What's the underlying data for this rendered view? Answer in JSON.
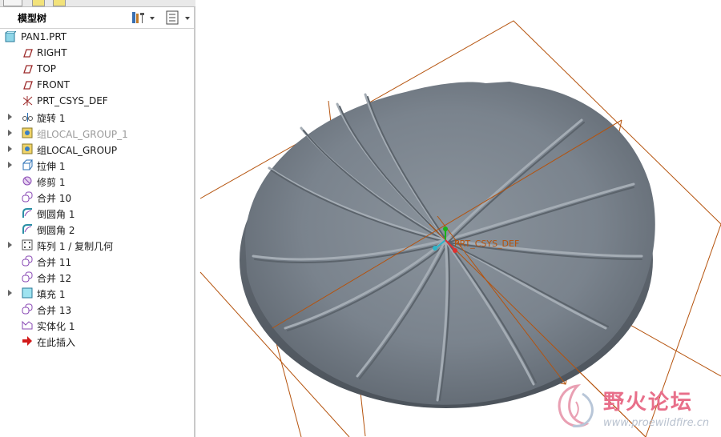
{
  "panel": {
    "title": "模型树",
    "settings_icon": "tree-settings-icon",
    "show_icon": "tree-columns-icon"
  },
  "tree": {
    "root": "PAN1.PRT",
    "items": [
      {
        "label": "RIGHT",
        "icon": "datum-plane-icon",
        "expandable": false,
        "dim": false
      },
      {
        "label": "TOP",
        "icon": "datum-plane-icon",
        "expandable": false,
        "dim": false
      },
      {
        "label": "FRONT",
        "icon": "datum-plane-icon",
        "expandable": false,
        "dim": false
      },
      {
        "label": "PRT_CSYS_DEF",
        "icon": "coordinate-system-icon",
        "expandable": false,
        "dim": false
      },
      {
        "label": "旋转 1",
        "icon": "revolve-icon",
        "expandable": true,
        "dim": false
      },
      {
        "label": "组LOCAL_GROUP_1",
        "icon": "group-icon",
        "expandable": true,
        "dim": true
      },
      {
        "label": "组LOCAL_GROUP",
        "icon": "group-icon",
        "expandable": true,
        "dim": false
      },
      {
        "label": "拉伸 1",
        "icon": "extrude-icon",
        "expandable": true,
        "dim": false
      },
      {
        "label": "修剪 1",
        "icon": "trim-icon",
        "expandable": false,
        "dim": false
      },
      {
        "label": "合并 10",
        "icon": "merge-icon",
        "expandable": false,
        "dim": false
      },
      {
        "label": "倒圆角 1",
        "icon": "round-icon",
        "expandable": false,
        "dim": false
      },
      {
        "label": "倒圆角 2",
        "icon": "round-icon",
        "expandable": false,
        "dim": false
      },
      {
        "label": "阵列 1 / 复制几何",
        "icon": "pattern-icon",
        "expandable": true,
        "dim": false
      },
      {
        "label": "合并 11",
        "icon": "merge-icon",
        "expandable": false,
        "dim": false
      },
      {
        "label": "合并 12",
        "icon": "merge-icon",
        "expandable": false,
        "dim": false
      },
      {
        "label": "填充 1",
        "icon": "fill-icon",
        "expandable": true,
        "dim": false
      },
      {
        "label": "合并 13",
        "icon": "merge-icon",
        "expandable": false,
        "dim": false
      },
      {
        "label": "实体化 1",
        "icon": "solidify-icon",
        "expandable": false,
        "dim": false
      },
      {
        "label": "在此插入",
        "icon": "insert-here-arrow-icon",
        "expandable": false,
        "dim": false
      }
    ]
  },
  "viewport": {
    "csys_label": "PRT_CSYS_DEF",
    "datum_color": "#b5530d",
    "part_color": "#7c8690"
  },
  "watermark": {
    "title": "野火论坛",
    "url": "www.proewildfire.cn"
  }
}
